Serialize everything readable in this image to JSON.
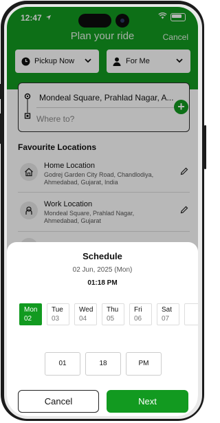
{
  "status": {
    "time": "12:47"
  },
  "header": {
    "title": "Plan your ride",
    "cancel_label": "Cancel"
  },
  "selectors": {
    "pickup_label": "Pickup Now",
    "for_label": "For Me"
  },
  "route": {
    "from": "Mondeal Square, Prahlad Nagar, A...",
    "to_placeholder": "Where to?"
  },
  "favourites": {
    "title": "Favourite Locations",
    "items": [
      {
        "name": "Home Location",
        "address": "Godrej Garden City Road, Chandlodiya, Ahmedabad, Gujarat, India"
      },
      {
        "name": "Work Location",
        "address": "Mondeal Square, Prahlad Nagar, Ahmedabad, Gujarat"
      }
    ]
  },
  "schedule": {
    "title": "Schedule",
    "date": "02 Jun, 2025 (Mon)",
    "time": "01:18 PM",
    "days": [
      {
        "name": "Mon",
        "date": "02",
        "selected": true
      },
      {
        "name": "Tue",
        "date": "03"
      },
      {
        "name": "Wed",
        "date": "04"
      },
      {
        "name": "Thu",
        "date": "05"
      },
      {
        "name": "Fri",
        "date": "06"
      },
      {
        "name": "Sat",
        "date": "07"
      }
    ],
    "hour": "01",
    "minute": "18",
    "ampm": "PM",
    "cancel_label": "Cancel",
    "next_label": "Next"
  },
  "colors": {
    "accent": "#129a20"
  }
}
